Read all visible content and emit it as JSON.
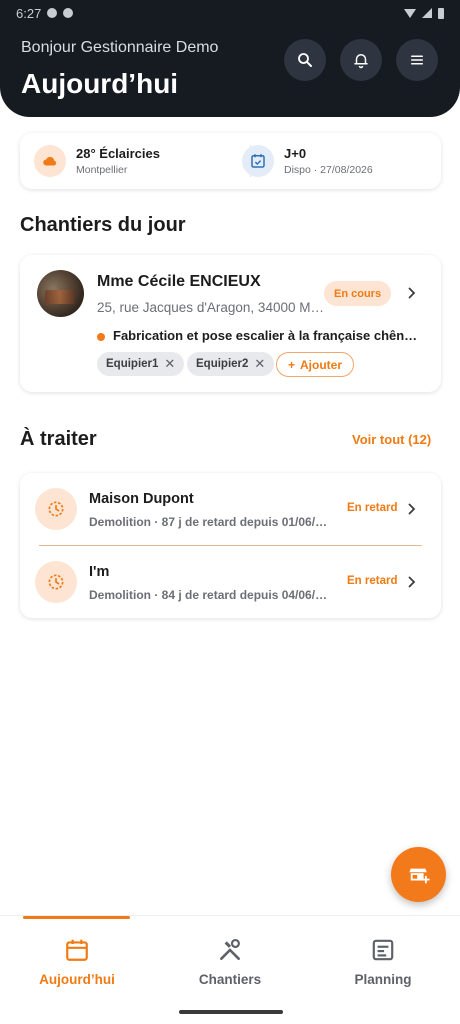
{
  "status_bar": {
    "time": "6:27"
  },
  "header": {
    "greeting": "Bonjour Gestionnaire Demo",
    "title": "Aujourd’hui"
  },
  "info": {
    "weather": {
      "title": "28° Éclaircies",
      "subtitle": "Montpellier"
    },
    "dispo": {
      "title": "J+0",
      "subtitle": "Dispo · 27/08/2026"
    }
  },
  "chantiers": {
    "section_title": "Chantiers du jour",
    "card": {
      "client": "Mme Cécile ENCIEUX",
      "address": "25, rue Jacques d'Aragon, 34000 M…",
      "status": "En cours",
      "task": "Fabrication et pose escalier à la française chên…",
      "teams": [
        "Equipier1",
        "Equipier2"
      ],
      "add_label": "Ajouter"
    }
  },
  "todo": {
    "section_title": "À traiter",
    "see_all": "Voir tout (12)",
    "items": [
      {
        "title": "Maison Dupont",
        "subtitle": "Demolition · 87 j de retard depuis 01/06/…",
        "status": "En retard"
      },
      {
        "title": "I'm",
        "subtitle": "Demolition · 84 j de retard depuis 04/06/…",
        "status": "En retard"
      }
    ]
  },
  "nav": {
    "items": [
      {
        "label": "Aujourd’hui",
        "icon": "calendar-icon",
        "active": true
      },
      {
        "label": "Chantiers",
        "icon": "tools-icon",
        "active": false
      },
      {
        "label": "Planning",
        "icon": "planning-icon",
        "active": false
      }
    ]
  },
  "colors": {
    "accent": "#F07A13",
    "header_bg": "#161B22",
    "badge_bg": "#FDE4D3"
  }
}
